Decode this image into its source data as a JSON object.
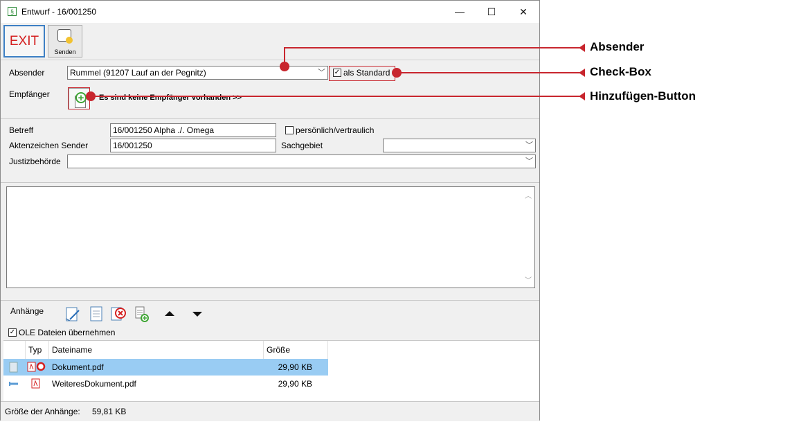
{
  "window": {
    "title": "Entwurf - 16/001250",
    "app_icon_glyph": "§",
    "minimize_glyph": "—",
    "maximize_glyph": "☐",
    "close_glyph": "✕"
  },
  "toolbar": {
    "exit_label": "EXIT",
    "send_label": "Senden"
  },
  "sender": {
    "label": "Absender",
    "value": "Rummel (91207 Lauf an der Pegnitz)",
    "default_checkbox_label": "als Standard",
    "default_checked": true
  },
  "recipient": {
    "label": "Empfänger",
    "none_text": "Es sind keine Empfänger vorhanden >>"
  },
  "form": {
    "subject_label": "Betreff",
    "subject_value": "16/001250 Alpha ./. Omega",
    "confidential_label": "persönlich/vertraulich",
    "confidential_checked": false,
    "reference_label": "Aktenzeichen Sender",
    "reference_value": "16/001250",
    "subject_area_label": "Sachgebiet",
    "subject_area_value": "",
    "court_label": "Justizbehörde",
    "court_value": ""
  },
  "attachments": {
    "label": "Anhänge",
    "ole_label": "OLE Dateien übernehmen",
    "ole_checked": true,
    "columns": [
      "Typ",
      "Dateiname",
      "Größe"
    ],
    "rows": [
      {
        "name": "Dokument.pdf",
        "size": "29,90 KB",
        "selected": true
      },
      {
        "name": "WeiteresDokument.pdf",
        "size": "29,90 KB",
        "selected": false
      }
    ]
  },
  "status": {
    "total_label": "Größe der Anhänge:",
    "total_value": "59,81 KB"
  },
  "callouts": {
    "sender": "Absender",
    "checkbox": "Check-Box",
    "add_button": "Hinzufügen-Button"
  },
  "colors": {
    "accent_red": "#c8262e",
    "selection": "#99ccf3",
    "exit_red": "#d42020",
    "add_green": "#3fa535"
  }
}
